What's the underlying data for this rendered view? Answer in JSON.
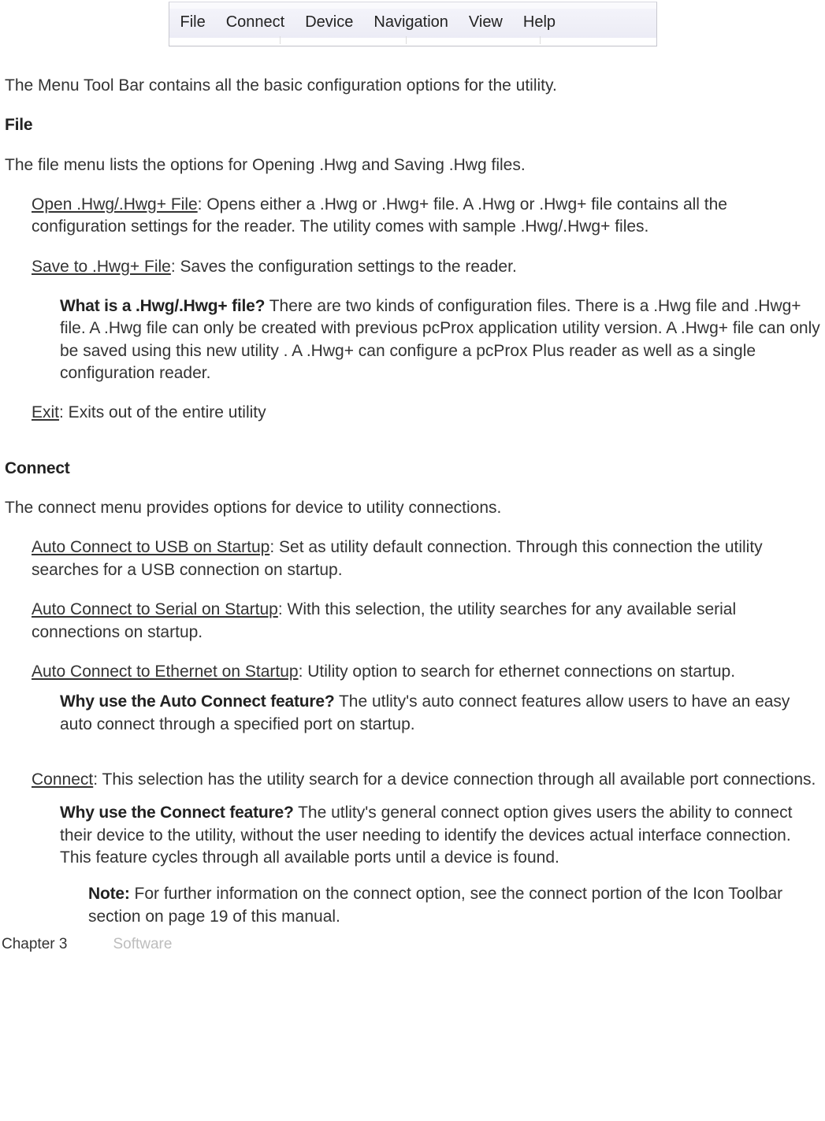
{
  "menubar": {
    "items": [
      "File",
      "Connect",
      "Device",
      "Navigation",
      "View",
      "Help"
    ]
  },
  "intro": "The Menu Tool Bar contains all the basic configuration options for the utility.",
  "file": {
    "heading": "File",
    "intro": "The file menu lists the options for Opening .Hwg and Saving .Hwg files.",
    "open": {
      "label": "Open .Hwg/.Hwg+ File",
      "desc": ": Opens either a .Hwg or .Hwg+ file.  A .Hwg or .Hwg+ file contains all the configuration settings for the reader. The utility comes with sample .Hwg/.Hwg+ files."
    },
    "save": {
      "label": "Save to .Hwg+ File",
      "desc": ": Saves the configuration settings to the reader."
    },
    "what": {
      "label": "What is a .Hwg/.Hwg+ file?",
      "desc": " There are two kinds of configuration files. There is a .Hwg file and .Hwg+ file. A .Hwg file can only be created with previous pcProx application utility version. A .Hwg+ file can only be saved using this new utility . A .Hwg+ can configure a pcProx Plus reader as well as a single configuration reader."
    },
    "exit": {
      "label": "Exit",
      "desc": ": Exits out of the entire utility"
    }
  },
  "connect": {
    "heading": "Connect",
    "intro": "The connect menu provides options for device to utility connections.",
    "usb": {
      "label": "Auto Connect to USB on Startup",
      "desc": ": Set as utility default connection. Through this connection the utility searches for a USB connection on startup."
    },
    "serial": {
      "label": "Auto Connect to Serial on Startup",
      "desc": ": With this selection, the utility searches for any available serial connections on startup."
    },
    "eth": {
      "label": "Auto Connect to Ethernet on Startup",
      "desc": ":  Utility option to search for ethernet connections on startup."
    },
    "why_auto": {
      "label": "Why use the Auto Connect feature?",
      "desc": " The utlity's auto connect features allow users to have an easy auto connect through a specified port on startup."
    },
    "conn": {
      "label": "Connect",
      "desc": ": This selection has the utility search for a device connection through all available port connections."
    },
    "why_conn": {
      "label": "Why use the Connect feature?",
      "desc": " The utlity's general connect option gives users the ability to connect their device to the utility, without the user needing to identify the devices actual interface connection. This feature cycles through all available ports until a device is found."
    },
    "note": {
      "label": "Note:",
      "desc": " For further information on the connect option, see the connect portion of the Icon Toolbar section on page 19 of this manual."
    }
  },
  "footer": {
    "chapter": "Chapter 3",
    "section": "Software"
  },
  "menubar_positions": [
    8,
    66,
    166,
    254,
    388,
    456,
    520
  ],
  "menubar_gaps": [
    "",
    "  ",
    "  ",
    "  ",
    "  ",
    "  ",
    ""
  ]
}
